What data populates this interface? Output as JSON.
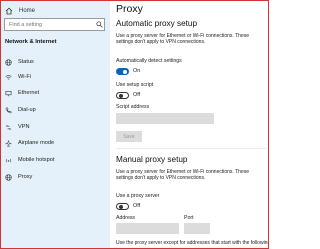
{
  "window": {
    "title": "Proxy"
  },
  "sidebar": {
    "home_label": "Home",
    "search_placeholder": "Find a setting",
    "section_title": "Network & Internet",
    "items": [
      {
        "label": "Status",
        "icon": "globe-icon"
      },
      {
        "label": "Wi-Fi",
        "icon": "wifi-icon"
      },
      {
        "label": "Ethernet",
        "icon": "ethernet-icon"
      },
      {
        "label": "Dial-up",
        "icon": "phone-icon"
      },
      {
        "label": "VPN",
        "icon": "vpn-icon"
      },
      {
        "label": "Airplane mode",
        "icon": "airplane-icon"
      },
      {
        "label": "Mobile hotspot",
        "icon": "hotspot-icon"
      },
      {
        "label": "Proxy",
        "icon": "globe-icon"
      }
    ]
  },
  "auto": {
    "heading": "Automatic proxy setup",
    "description": "Use a proxy server for Ethernet or Wi-Fi connections. These settings don't apply to VPN connections.",
    "detect_label": "Automatically detect settings",
    "detect_state": "On",
    "script_label": "Use setup script",
    "script_state": "Off",
    "address_label": "Script address",
    "save_label": "Save"
  },
  "manual": {
    "heading": "Manual proxy setup",
    "description": "Use a proxy server for Ethernet or Wi-Fi connections. These settings don't apply to VPN connections.",
    "use_label": "Use a proxy server",
    "use_state": "Off",
    "address_label": "Address",
    "port_label": "Port",
    "exceptions_label": "Use the proxy server except for addresses that start with the following"
  },
  "colors": {
    "accent": "#0067c0",
    "sidebar_bg": "#e5f1fa",
    "frame": "#d23333"
  }
}
